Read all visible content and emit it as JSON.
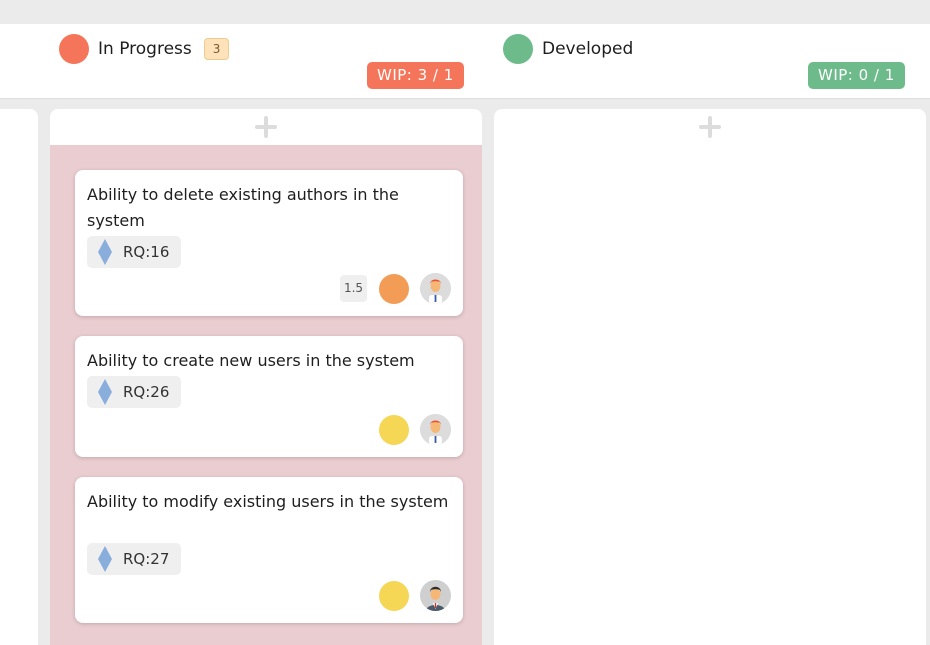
{
  "columns": [
    {
      "title": "In Progress",
      "count": "3",
      "dot_color": "#f47559",
      "wip": "WIP: 3 / 1",
      "wip_color": "#f47559"
    },
    {
      "title": "Developed",
      "dot_color": "#6dbb8a",
      "wip": "WIP: 0 / 1",
      "wip_color": "#6dbb8a"
    }
  ],
  "add_icon": "plus-icon",
  "cards": [
    {
      "title": "Ability to delete existing authors in the system",
      "tag": "RQ:16",
      "tag_icon": "diamond-icon",
      "points": "1.5",
      "priority_color": "#f39c55",
      "assignee_icon": "avatar-redhair-icon"
    },
    {
      "title": "Ability to create new users in the system",
      "tag": "RQ:26",
      "tag_icon": "diamond-icon",
      "priority_color": "#f5d655",
      "assignee_icon": "avatar-redhair-icon"
    },
    {
      "title": "Ability to modify existing users in the system",
      "tag": "RQ:27",
      "tag_icon": "diamond-icon",
      "priority_color": "#f5d655",
      "assignee_icon": "avatar-darkhair-icon"
    }
  ],
  "colors": {
    "lane_body": "#eacdd0",
    "background": "#ebebeb",
    "tag_diamond": "#8aaedc"
  }
}
